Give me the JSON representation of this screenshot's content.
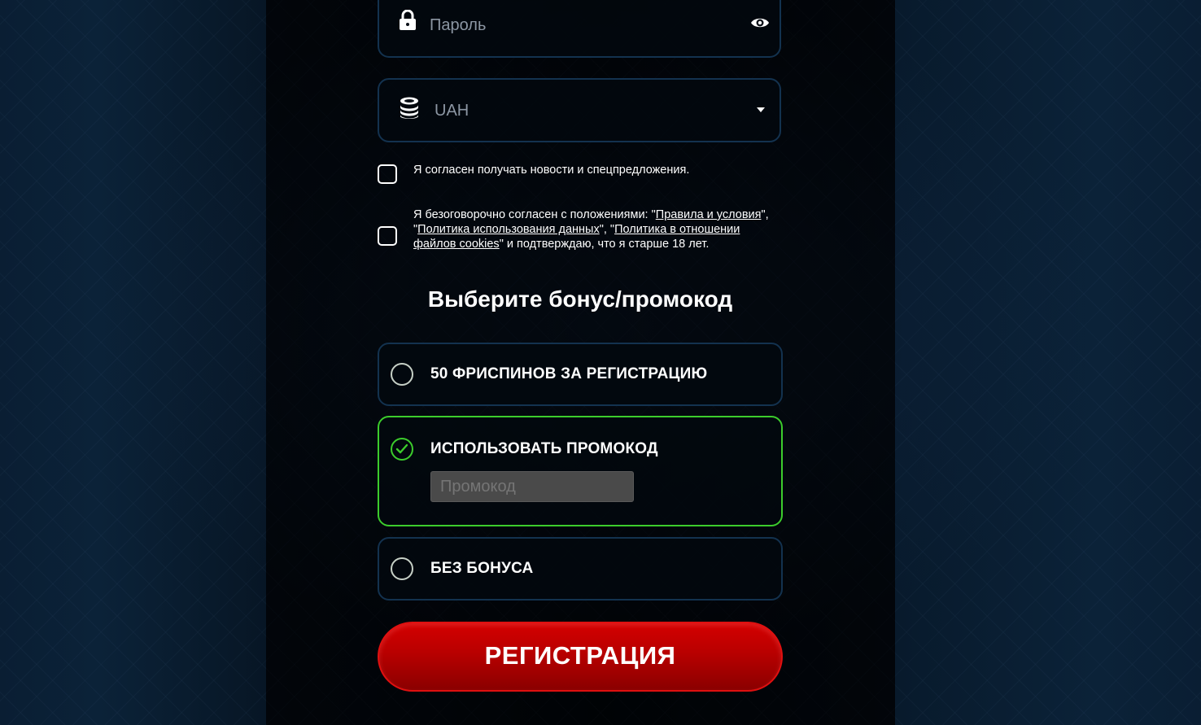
{
  "password_field": {
    "placeholder": "Пароль",
    "lead_icon": "lock-icon",
    "trail_icon": "eye-icon"
  },
  "currency_field": {
    "value": "UAH",
    "lead_icon": "coins-icon",
    "trail_icon": "dropdown-arrow-icon"
  },
  "checkboxes": {
    "news": {
      "checked": false,
      "label": "Я согласен получать новости и спецпредложения."
    },
    "terms": {
      "checked": false,
      "prefix": "Я безоговорочно согласен с положениями: \"",
      "link1": "Правила и условия",
      "sep1": "\", \"",
      "link2": "Политика использования данных",
      "sep2": "\", \"",
      "link3": "Политика в отношении файлов cookies",
      "suffix": "\" и подтверждаю, что я старше 18 лет."
    }
  },
  "bonus_section": {
    "title": "Выберите бонус/промокод",
    "options": [
      {
        "label": "50 ФРИСПИНОВ ЗА РЕГИСТРАЦИЮ",
        "selected": false
      },
      {
        "label": "ИСПОЛЬЗОВАТЬ ПРОМОКОД",
        "selected": true
      },
      {
        "label": "БЕЗ БОНУСА",
        "selected": false
      }
    ],
    "promo_placeholder": "Промокод"
  },
  "register_button": {
    "label": "РЕГИСТРАЦИЯ"
  },
  "colors": {
    "accent_green": "#3ccc2c",
    "button_red": "#c40000",
    "field_border": "#13324f",
    "text_muted": "#8c96a3"
  }
}
